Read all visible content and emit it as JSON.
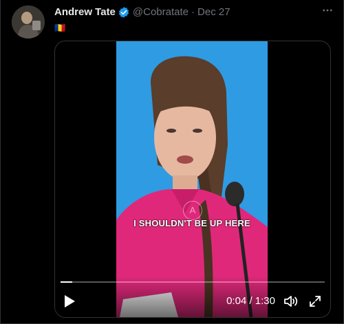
{
  "tweet": {
    "author": {
      "display_name": "Andrew Tate",
      "handle": "@Cobratate",
      "verified": true
    },
    "separator": "·",
    "date": "Dec 27",
    "text": "🇷🇴",
    "more_icon": "more-horizontal-icon"
  },
  "video": {
    "caption": "I SHOULDN'T BE UP HERE",
    "watermark": "A",
    "progress": 0.044,
    "current_time": "0:04",
    "duration": "1:30",
    "time_display": "0:04 / 1:30",
    "icons": {
      "play": "play-icon",
      "volume": "volume-icon",
      "fullscreen": "fullscreen-icon"
    }
  },
  "colors": {
    "background": "#000000",
    "text_primary": "#e7e9ea",
    "text_secondary": "#71767b",
    "verified_blue": "#1d9bf0",
    "border": "#2f3336",
    "video_bg": "#2f9be3",
    "shirt": "#e0287a"
  }
}
